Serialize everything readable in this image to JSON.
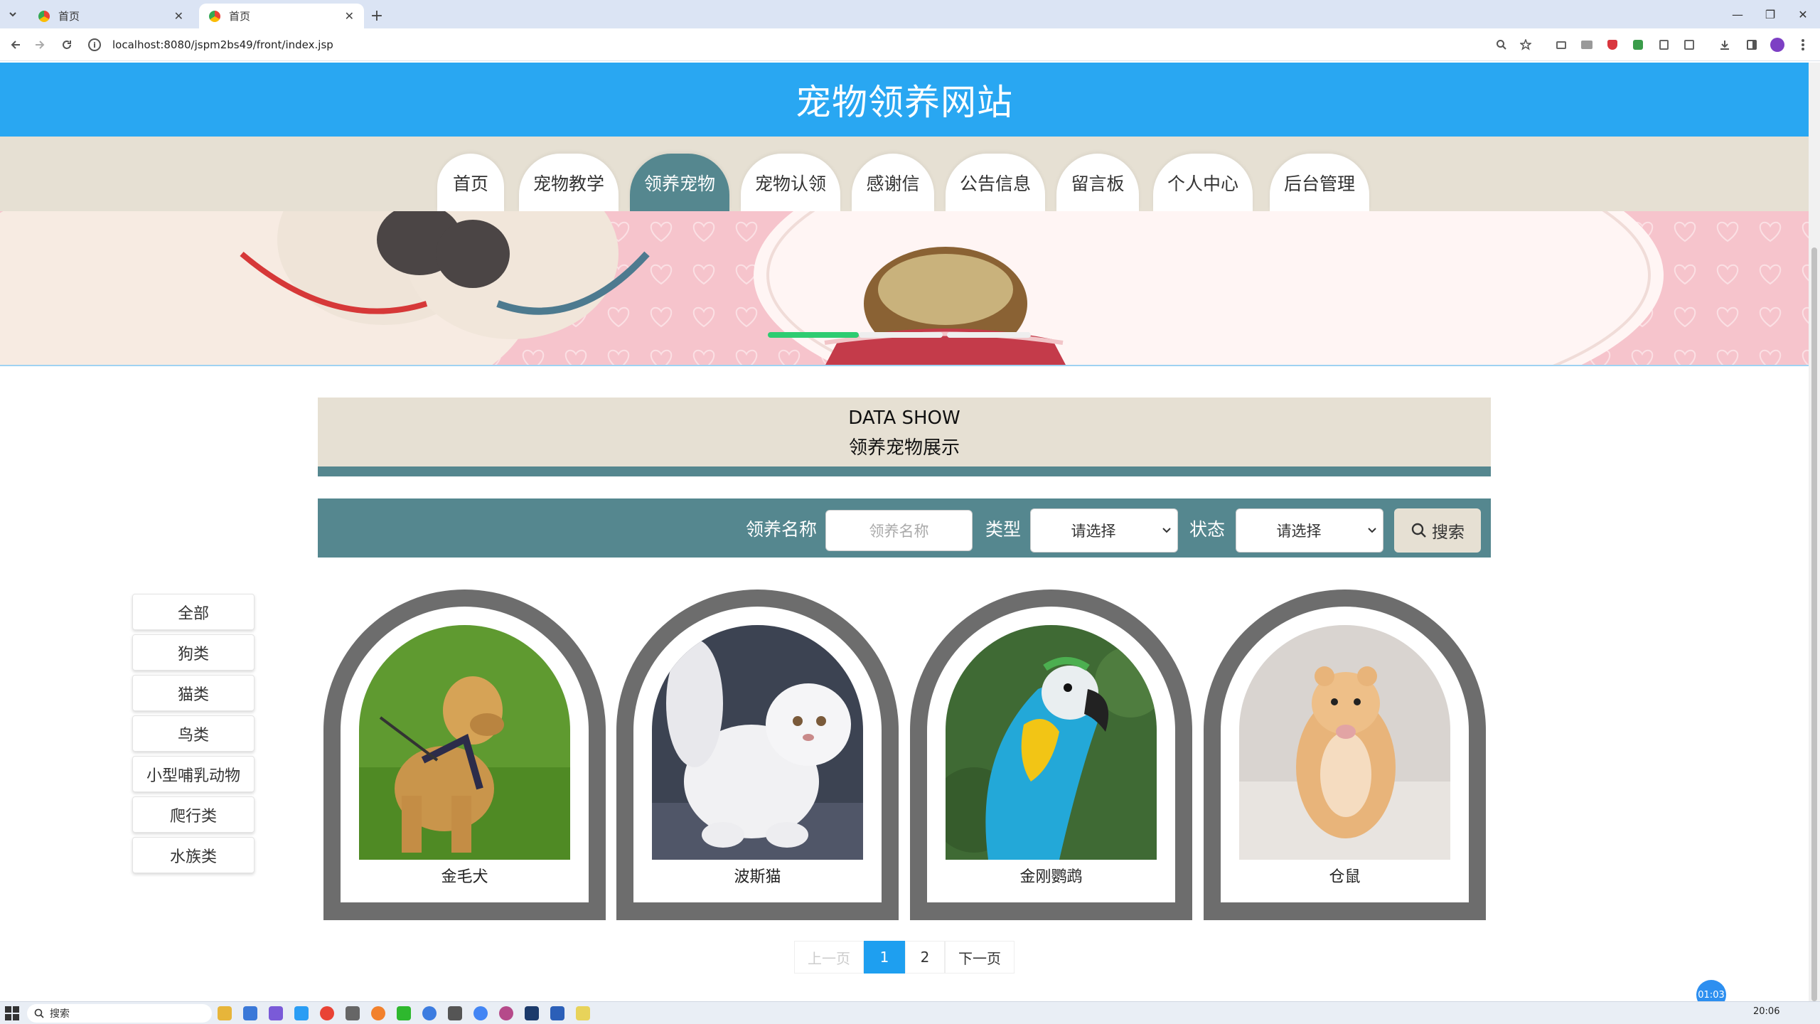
{
  "browser": {
    "tabs": [
      {
        "title": "首页",
        "active": false
      },
      {
        "title": "首页",
        "active": true
      }
    ],
    "url": "localhost:8080/jspm2bs49/front/index.jsp"
  },
  "site": {
    "title": "宠物领养网站",
    "nav": [
      "首页",
      "宠物教学",
      "领养宠物",
      "宠物认领",
      "感谢信",
      "公告信息",
      "留言板",
      "个人中心",
      "后台管理"
    ],
    "active_nav": "领养宠物"
  },
  "section": {
    "title_en": "DATA SHOW",
    "title_cn": "领养宠物展示"
  },
  "search": {
    "name_label": "领养名称",
    "name_placeholder": "领养名称",
    "type_label": "类型",
    "type_value": "请选择",
    "status_label": "状态",
    "status_value": "请选择",
    "button_label": "搜索"
  },
  "categories": [
    "全部",
    "狗类",
    "猫类",
    "鸟类",
    "小型哺乳动物",
    "爬行类",
    "水族类"
  ],
  "pets": [
    {
      "name": "金毛犬"
    },
    {
      "name": "波斯猫"
    },
    {
      "name": "金刚鹦鹉"
    },
    {
      "name": "仓鼠"
    }
  ],
  "pagination": {
    "prev": "上一页",
    "pages": [
      "1",
      "2"
    ],
    "current": "1",
    "next": "下一页"
  },
  "timer": "01:03",
  "taskbar": {
    "search_label": "搜索",
    "time": "20:06"
  },
  "colors": {
    "header": "#29a7f2",
    "nav_bg": "#e6e0d3",
    "accent": "#55878f",
    "card_frame": "#6d6d6d",
    "page_current": "#1e9ff0"
  }
}
